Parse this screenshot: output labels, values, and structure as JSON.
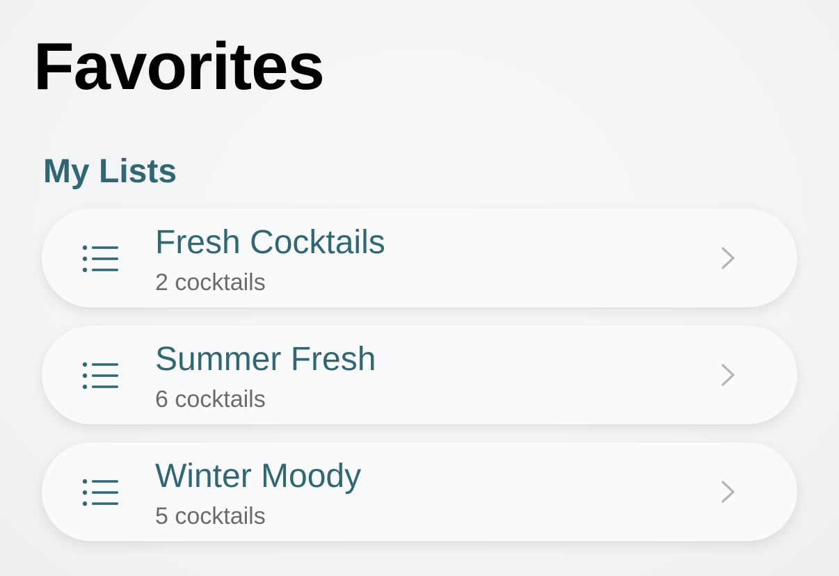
{
  "header": {
    "title": "Favorites"
  },
  "section": {
    "title": "My Lists"
  },
  "lists": [
    {
      "name": "Fresh Cocktails",
      "count_label": "2 cocktails",
      "icon": "list-bullet-icon"
    },
    {
      "name": "Summer Fresh",
      "count_label": "6 cocktails",
      "icon": "list-bullet-icon"
    },
    {
      "name": "Winter Moody",
      "count_label": "5 cocktails",
      "icon": "list-bullet-icon"
    }
  ],
  "colors": {
    "accent": "#306773",
    "secondary_text": "#6b6b6b",
    "chevron": "#b3b3b3",
    "card_background": "#f9fafc"
  }
}
